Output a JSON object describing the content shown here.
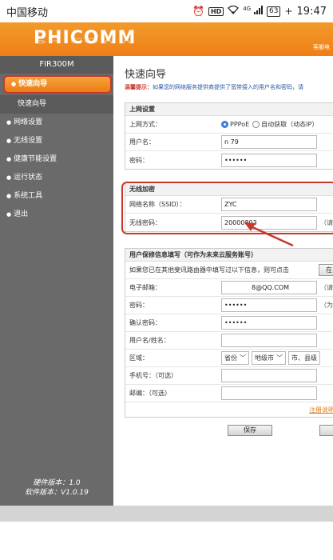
{
  "status_bar": {
    "carrier": "中国移动",
    "network": "4G",
    "hd": "HD",
    "battery": "63",
    "time": "19:47"
  },
  "header": {
    "logo": "PHICOMM",
    "right_link": "客服电"
  },
  "sidebar": {
    "model": "FIR300M",
    "items": [
      {
        "label": "快速向导"
      },
      {
        "label": "快速向导"
      },
      {
        "label": "网络设置"
      },
      {
        "label": "无线设置"
      },
      {
        "label": "健康节能设置"
      },
      {
        "label": "运行状态"
      },
      {
        "label": "系统工具"
      },
      {
        "label": "退出"
      }
    ],
    "hw_version": "硬件版本：1.0",
    "sw_version": "软件版本：V1.0.19"
  },
  "main": {
    "title": "快速向导",
    "tip_label": "温馨提示：",
    "tip_text": "如果您的网络服务提供商提供了宽带接入的用户名和密码，请",
    "internet": {
      "header": "上网设置",
      "mode_label": "上网方式：",
      "mode_pppoe": "PPPoE",
      "mode_dhcp": "自动获取（动态IP）",
      "username_label": "用户名：",
      "username_value": "n                79",
      "password_label": "密码：",
      "password_value": "••••••"
    },
    "wireless": {
      "header": "无线加密",
      "ssid_label": "网络名称（SSID）：",
      "ssid_value": "ZYC",
      "wifi_password_label": "无线密码：",
      "wifi_password_value": "20000803",
      "wifi_password_hint": "（请"
    },
    "warranty": {
      "header": "用户保修信息填写（可作为未来云服务账号）",
      "note": "如果您已在其他斐讯路由器中填写过以下信息，则可点击",
      "note_button": "在",
      "email_label": "电子邮箱：",
      "email_value": "8@QQ.COM",
      "email_hint": "（请",
      "password_label": "密码：",
      "password_value": "••••••",
      "password_hint": "（为",
      "confirm_label": "确认密码：",
      "confirm_value": "••••••",
      "name_label": "用户名/姓名：",
      "region_label": "区域：",
      "province": "省份",
      "city": "地级市",
      "county": "市、县级",
      "phone_label": "手机号：（可选）",
      "zip_label": "邮编：（可选）",
      "register_link": "注册说明"
    },
    "save_button": "保存"
  }
}
